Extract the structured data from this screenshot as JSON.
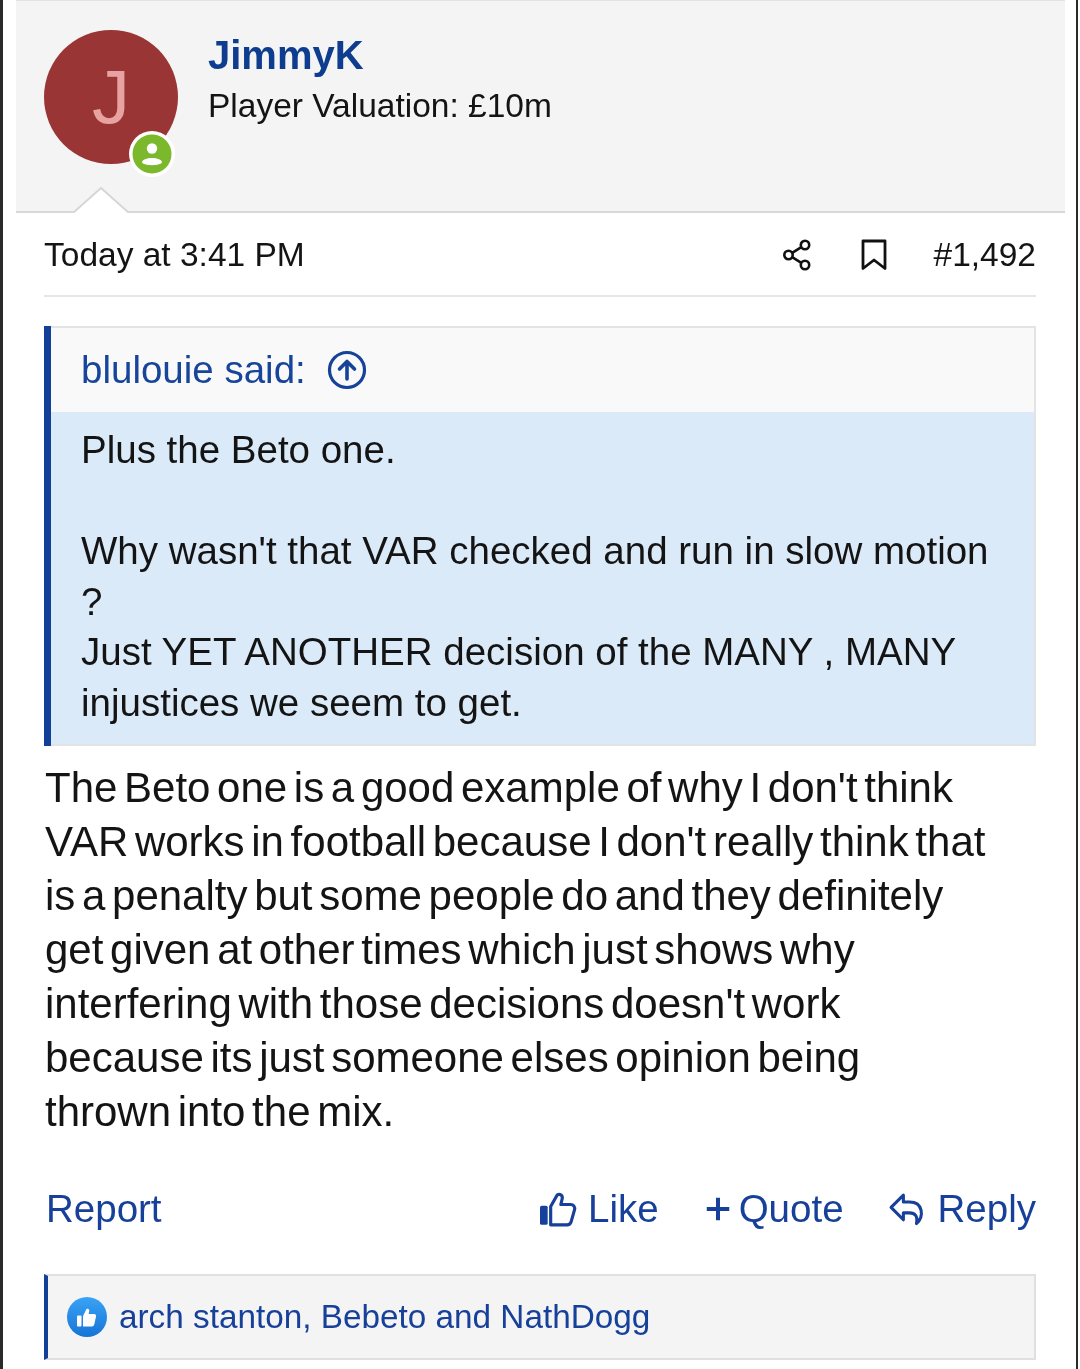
{
  "author": {
    "initial": "J",
    "name": "JimmyK",
    "title": "Player Valuation: £10m"
  },
  "meta": {
    "date": "Today at 3:41 PM",
    "post_number": "#1,492"
  },
  "quote": {
    "attribution": "blulouie said:",
    "paragraphs": [
      "Plus the Beto one.",
      "Why wasn't that VAR checked and run in slow motion ?\nJust YET ANOTHER decision of the MANY , MANY injustices we seem to get."
    ]
  },
  "body": "The Beto one is a good example of why I don't think VAR works in football because I don't really think that is a penalty but some people do and they definitely get given at other times which just shows why interfering with those decisions doesn't work because its just someone elses opinion being thrown into the mix.",
  "actions": {
    "report": "Report",
    "buttons": [
      {
        "kind": "like",
        "label": "Like"
      },
      {
        "kind": "quote",
        "label": "Quote"
      },
      {
        "kind": "reply",
        "label": "Reply"
      }
    ]
  },
  "reactions": {
    "text": "arch stanton, Bebeto and NathDogg"
  }
}
